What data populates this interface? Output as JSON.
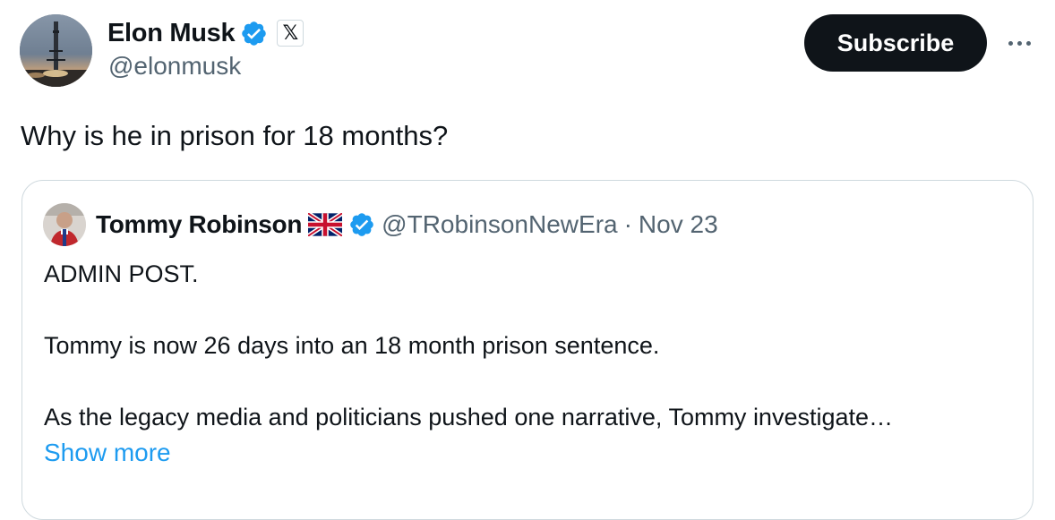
{
  "author": {
    "display_name": "Elon Musk",
    "handle": "@elonmusk",
    "verified_icon": "verified-badge-icon",
    "affiliation_icon": "x-logo-icon",
    "affiliation_glyph": "𝕏"
  },
  "actions": {
    "subscribe_label": "Subscribe",
    "more_icon": "more-horizontal-icon"
  },
  "tweet": {
    "text": "Why is he in prison for 18 months?"
  },
  "quoted_tweet": {
    "display_name": "Tommy Robinson",
    "flag_icon": "uk-flag-icon",
    "verified_icon": "verified-badge-icon",
    "handle": "@TRobinsonNewEra",
    "separator": "·",
    "date": "Nov 23",
    "lines": [
      "ADMIN POST.",
      "Tommy is now 26 days into an 18 month prison sentence.",
      "As the legacy media and politicians pushed one narrative, Tommy investigate…"
    ],
    "show_more_label": "Show more"
  },
  "colors": {
    "text_primary": "#0f1419",
    "text_secondary": "#536471",
    "link": "#1d9bf0",
    "verified": "#1d9bf0",
    "border": "#cfd9de",
    "button_bg": "#0f1419"
  }
}
